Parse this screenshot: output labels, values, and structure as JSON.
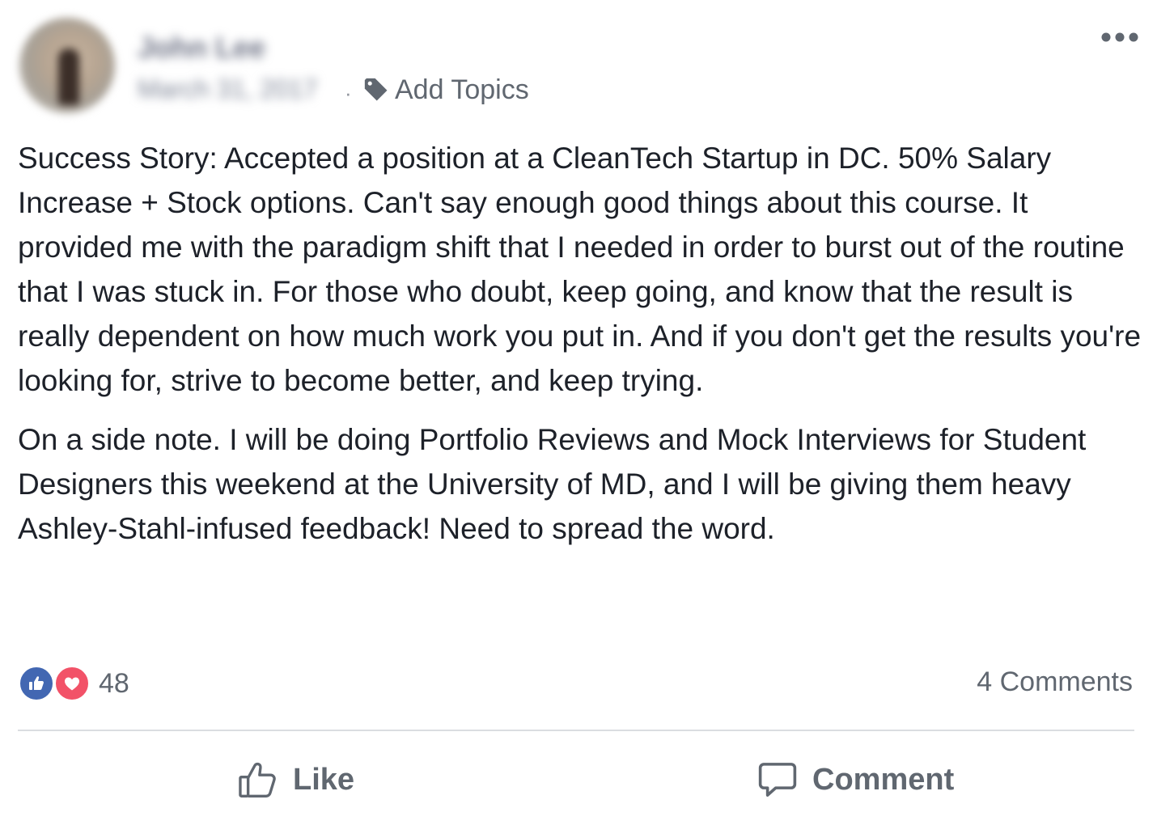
{
  "post": {
    "author_name": "John Lee",
    "date": "March 31, 2017",
    "meta_separator": "·",
    "add_topics_label": "Add Topics",
    "more_label": "•••",
    "paragraphs": [
      "Success Story: Accepted a position at a CleanTech Startup in DC. 50% Salary Increase + Stock options. Can't say enough good things about this course. It provided me with the paradigm shift that I needed in order to burst out of the routine that I was stuck in. For those who doubt, keep going, and know that the result is really dependent on how much work you put in. And if you don't get the results you're looking for, strive to become better, and keep trying.",
      "On a side note. I will be doing Portfolio Reviews and Mock Interviews for Student Designers this weekend at the University of MD, and I will be giving them heavy Ashley-Stahl-infused feedback! Need to spread the word."
    ]
  },
  "reactions": {
    "count": "48",
    "types": [
      "like-icon",
      "love-icon"
    ],
    "like_color": "#4267b2",
    "love_color": "#f25268"
  },
  "comments": {
    "count_label": "4 Comments"
  },
  "actions": {
    "like_label": "Like",
    "comment_label": "Comment"
  },
  "icons": {
    "tag": "tag-icon",
    "more": "more-options-icon",
    "like": "thumbs-up-icon",
    "comment": "speech-bubble-icon"
  },
  "colors": {
    "text": "#1d2129",
    "secondary_text": "#606770",
    "divider": "#dadde1"
  }
}
